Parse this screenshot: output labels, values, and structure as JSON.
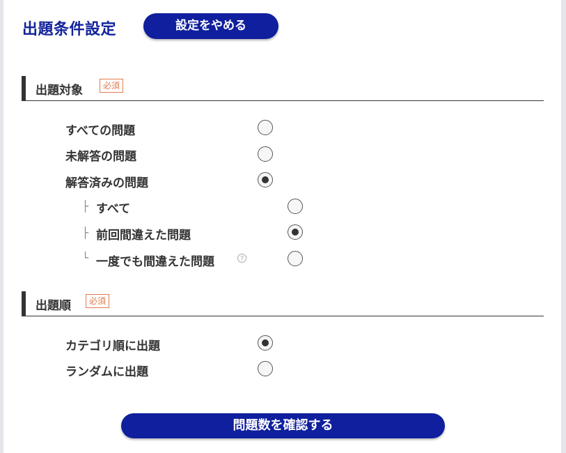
{
  "header": {
    "title": "出題条件設定",
    "cancel_label": "設定をやめる"
  },
  "sections": [
    {
      "title": "出題対象",
      "badge": "必須",
      "options": [
        {
          "label": "すべての問題",
          "checked": false
        },
        {
          "label": "未解答の問題",
          "checked": false
        },
        {
          "label": "解答済みの問題",
          "checked": true
        }
      ],
      "sub_options": [
        {
          "tree": "├",
          "label": "すべて",
          "checked": false
        },
        {
          "tree": "├",
          "label": "前回間違えた問題",
          "checked": true
        },
        {
          "tree": "└",
          "label": "一度でも間違えた問題",
          "checked": false,
          "help_icon": "?"
        }
      ]
    },
    {
      "title": "出題順",
      "badge": "必須",
      "options": [
        {
          "label": "カテゴリ順に出題",
          "checked": true
        },
        {
          "label": "ランダムに出題",
          "checked": false
        }
      ]
    }
  ],
  "footer": {
    "confirm_label": "問題数を確認する"
  },
  "colors": {
    "primary": "#0f1f9e",
    "title": "#13239a",
    "badge": "#e07a4f",
    "text": "#333333"
  }
}
